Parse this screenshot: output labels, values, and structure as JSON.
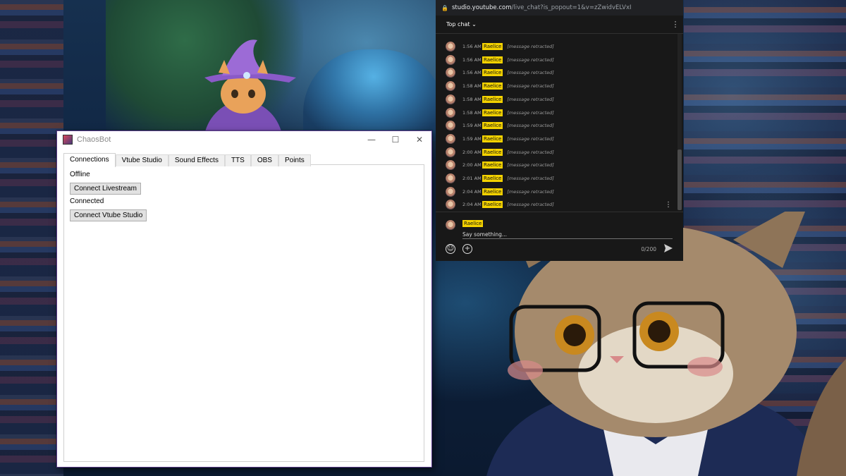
{
  "chaosbot": {
    "title": "ChaosBot",
    "tabs": [
      "Connections",
      "Vtube Studio",
      "Sound Effects",
      "TTS",
      "OBS",
      "Points"
    ],
    "active_tab": "Connections",
    "livestream_status": "Offline",
    "connect_livestream_label": "Connect Livestream",
    "vtube_status": "Connected",
    "connect_vtube_label": "Connect Vtube Studio"
  },
  "youtube_chat": {
    "url_host": "studio.youtube.com",
    "url_path": "/live_chat?is_popout=1&v=zZwidvELVxI",
    "mode": "Top chat",
    "messages": [
      {
        "time": "1:56 AM",
        "author": "Raelice",
        "text": "[message retracted]"
      },
      {
        "time": "1:56 AM",
        "author": "Raelice",
        "text": "[message retracted]"
      },
      {
        "time": "1:56 AM",
        "author": "Raelice",
        "text": "[message retracted]"
      },
      {
        "time": "1:58 AM",
        "author": "Raelice",
        "text": "[message retracted]"
      },
      {
        "time": "1:58 AM",
        "author": "Raelice",
        "text": "[message retracted]"
      },
      {
        "time": "1:58 AM",
        "author": "Raelice",
        "text": "[message retracted]"
      },
      {
        "time": "1:59 AM",
        "author": "Raelice",
        "text": "[message retracted]"
      },
      {
        "time": "1:59 AM",
        "author": "Raelice",
        "text": "[message retracted]"
      },
      {
        "time": "2:00 AM",
        "author": "Raelice",
        "text": "[message retracted]"
      },
      {
        "time": "2:00 AM",
        "author": "Raelice",
        "text": "[message retracted]"
      },
      {
        "time": "2:01 AM",
        "author": "Raelice",
        "text": "[message retracted]"
      },
      {
        "time": "2:04 AM",
        "author": "Raelice",
        "text": "[message retracted]"
      },
      {
        "time": "2:04 AM",
        "author": "Raelice",
        "text": "[message retracted]"
      },
      {
        "time": "2:04 AM",
        "author": "Raelice",
        "text": "[message retracted]"
      }
    ],
    "composer": {
      "user": "Raelice",
      "placeholder": "Say something...",
      "counter": "0/200"
    }
  },
  "colors": {
    "badge": "#f4d200",
    "chat_bg": "#181818",
    "window_border": "#5b3c8c"
  }
}
